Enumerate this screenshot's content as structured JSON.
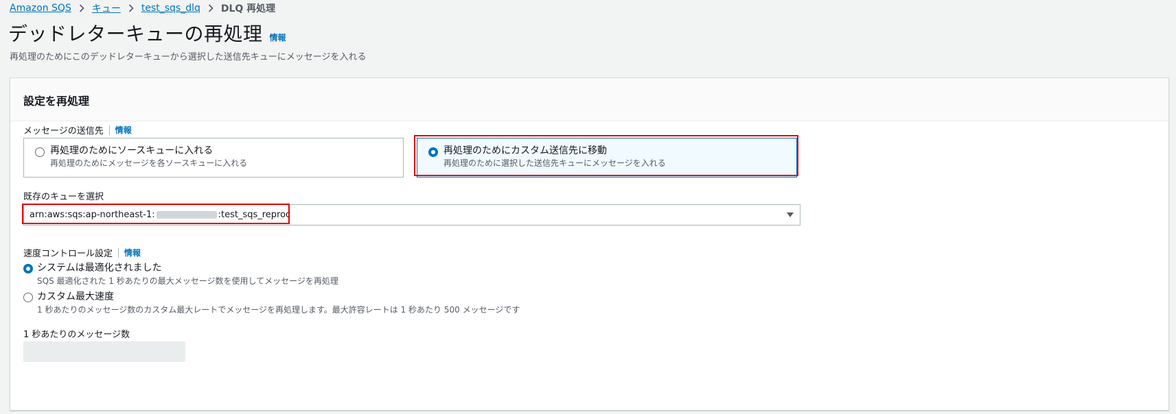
{
  "breadcrumb": {
    "items": [
      "Amazon SQS",
      "キュー",
      "test_sqs_dlq"
    ],
    "current": "DLQ 再処理"
  },
  "header": {
    "title": "デッドレターキューの再処理",
    "info": "情報",
    "description": "再処理のためにこのデッドレターキューから選択した送信先キューにメッセージを入れる"
  },
  "panel": {
    "title": "設定を再処理",
    "destination": {
      "label": "メッセージの送信先",
      "info": "情報",
      "options": [
        {
          "title": "再処理のためにソースキューに入れる",
          "desc": "再処理のためにメッセージを各ソースキューに入れる",
          "selected": false
        },
        {
          "title": "再処理のためにカスタム送信先に移動",
          "desc": "再処理のために選択した送信先キューにメッセージを入れる",
          "selected": true
        }
      ]
    },
    "queue_select": {
      "label": "既存のキューを選択",
      "value_prefix": "arn:aws:sqs:ap-northeast-1:",
      "value_suffix": ":test_sqs_reproc"
    },
    "velocity": {
      "label": "速度コントロール設定",
      "info": "情報",
      "options": [
        {
          "title": "システムは最適化されました",
          "desc": "SQS 最適化された 1 秒あたりの最大メッセージ数を使用してメッセージを再処理",
          "selected": true
        },
        {
          "title": "カスタム最大速度",
          "desc": "1 秒あたりのメッセージ数のカスタム最大レートでメッセージを再処理します。最大許容レートは 1 秒あたり 500 メッセージです",
          "selected": false
        }
      ]
    },
    "rate": {
      "label": "1 秒あたりのメッセージ数",
      "value": ""
    }
  },
  "colors": {
    "link": "#0073bb",
    "highlight": "#e00000",
    "selected_tile_bg": "#f1faff"
  }
}
